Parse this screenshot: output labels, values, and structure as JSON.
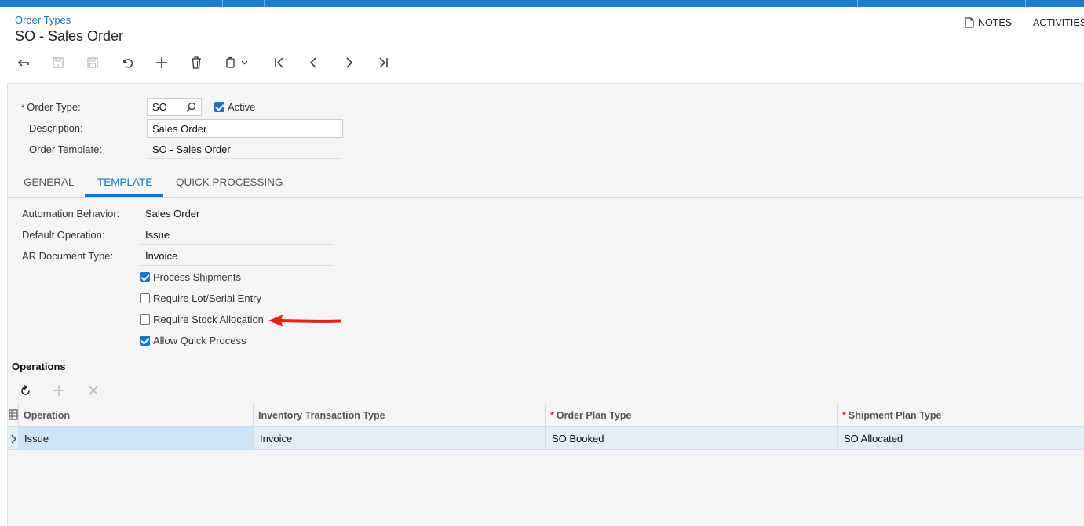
{
  "header": {
    "breadcrumb": "Order Types",
    "title": "SO - Sales Order",
    "notes_label": "NOTES",
    "activities_label": "ACTIVITIES"
  },
  "toolbar": {
    "icons": [
      "back-icon",
      "save-close-icon",
      "save-icon",
      "undo-icon",
      "add-icon",
      "delete-icon",
      "copy-paste-icon",
      "first-icon",
      "previous-icon",
      "next-icon",
      "last-icon"
    ]
  },
  "form": {
    "order_type_label": "Order Type:",
    "order_type_value": "SO",
    "active_label": "Active",
    "active_checked": true,
    "description_label": "Description:",
    "description_value": "Sales Order",
    "order_template_label": "Order Template:",
    "order_template_value": "SO - Sales Order"
  },
  "tabs": [
    {
      "label": "GENERAL",
      "active": false
    },
    {
      "label": "TEMPLATE",
      "active": true
    },
    {
      "label": "QUICK PROCESSING",
      "active": false
    }
  ],
  "template": {
    "automation_behavior_label": "Automation Behavior:",
    "automation_behavior_value": "Sales Order",
    "default_operation_label": "Default Operation:",
    "default_operation_value": "Issue",
    "ar_document_type_label": "AR Document Type:",
    "ar_document_type_value": "Invoice",
    "checkboxes": [
      {
        "label": "Process Shipments",
        "checked": true
      },
      {
        "label": "Require Lot/Serial Entry",
        "checked": false
      },
      {
        "label": "Require Stock Allocation",
        "checked": false
      },
      {
        "label": "Allow Quick Process",
        "checked": true
      }
    ]
  },
  "operations": {
    "title": "Operations",
    "columns": [
      "Operation",
      "Inventory Transaction Type",
      "Order Plan Type",
      "Shipment Plan Type"
    ],
    "rows": [
      {
        "operation": "Issue",
        "inventory_transaction_type": "Invoice",
        "order_plan_type": "SO Booked",
        "shipment_plan_type": "SO Allocated"
      }
    ]
  },
  "colors": {
    "accent": "#1a73c5",
    "topbar": "#1b7ed4",
    "annotation_arrow": "#e3201b"
  }
}
